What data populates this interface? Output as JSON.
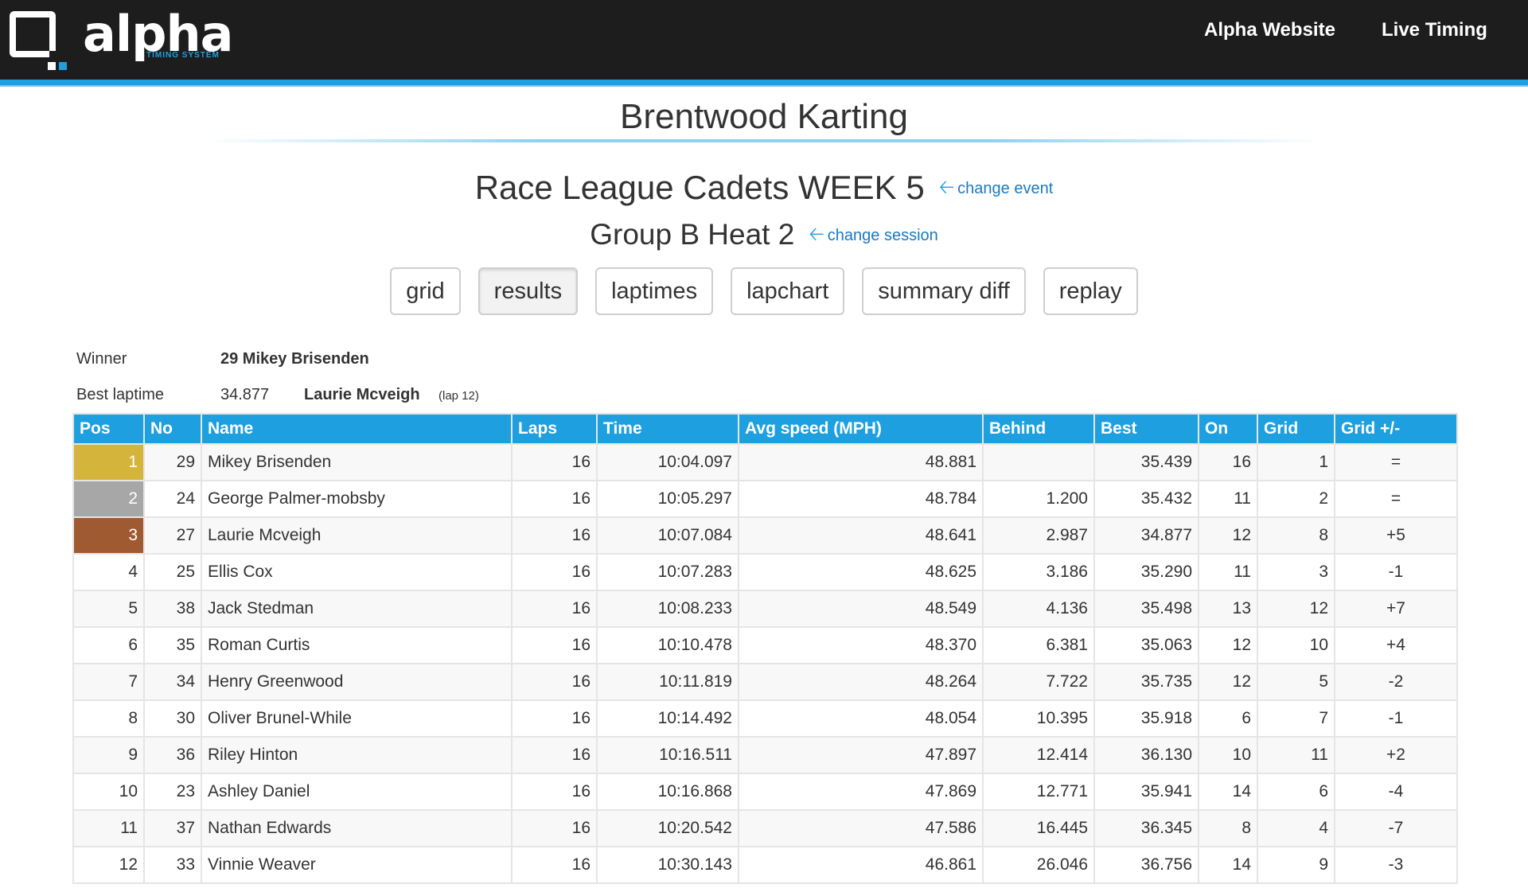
{
  "header": {
    "logo_text": "alpha",
    "logo_sub": "TIMING SYSTEM",
    "nav": [
      "Alpha Website",
      "Live Timing"
    ]
  },
  "venue": "Brentwood Karting",
  "event": {
    "title": "Race League Cadets WEEK 5",
    "change_label": "change event"
  },
  "session": {
    "title": "Group B Heat 2",
    "change_label": "change session"
  },
  "tabs": [
    "grid",
    "results",
    "laptimes",
    "lapchart",
    "summary diff",
    "replay"
  ],
  "active_tab": "results",
  "summary": {
    "winner_label": "Winner",
    "winner_value": "29 Mikey Brisenden",
    "best_label": "Best laptime",
    "best_time": "34.877",
    "best_driver": "Laurie Mcveigh",
    "best_lap": "(lap 12)"
  },
  "table": {
    "columns": [
      "Pos",
      "No",
      "Name",
      "Laps",
      "Time",
      "Avg speed (MPH)",
      "Behind",
      "Best",
      "On",
      "Grid",
      "Grid +/-"
    ],
    "rows": [
      [
        "1",
        "29",
        "Mikey Brisenden",
        "16",
        "10:04.097",
        "48.881",
        "",
        "35.439",
        "16",
        "1",
        "="
      ],
      [
        "2",
        "24",
        "George Palmer-mobsby",
        "16",
        "10:05.297",
        "48.784",
        "1.200",
        "35.432",
        "11",
        "2",
        "="
      ],
      [
        "3",
        "27",
        "Laurie Mcveigh",
        "16",
        "10:07.084",
        "48.641",
        "2.987",
        "34.877",
        "12",
        "8",
        "+5"
      ],
      [
        "4",
        "25",
        "Ellis Cox",
        "16",
        "10:07.283",
        "48.625",
        "3.186",
        "35.290",
        "11",
        "3",
        "-1"
      ],
      [
        "5",
        "38",
        "Jack Stedman",
        "16",
        "10:08.233",
        "48.549",
        "4.136",
        "35.498",
        "13",
        "12",
        "+7"
      ],
      [
        "6",
        "35",
        "Roman Curtis",
        "16",
        "10:10.478",
        "48.370",
        "6.381",
        "35.063",
        "12",
        "10",
        "+4"
      ],
      [
        "7",
        "34",
        "Henry Greenwood",
        "16",
        "10:11.819",
        "48.264",
        "7.722",
        "35.735",
        "12",
        "5",
        "-2"
      ],
      [
        "8",
        "30",
        "Oliver Brunel-While",
        "16",
        "10:14.492",
        "48.054",
        "10.395",
        "35.918",
        "6",
        "7",
        "-1"
      ],
      [
        "9",
        "36",
        "Riley Hinton",
        "16",
        "10:16.511",
        "47.897",
        "12.414",
        "36.130",
        "10",
        "11",
        "+2"
      ],
      [
        "10",
        "23",
        "Ashley Daniel",
        "16",
        "10:16.868",
        "47.869",
        "12.771",
        "35.941",
        "14",
        "6",
        "-4"
      ],
      [
        "11",
        "37",
        "Nathan Edwards",
        "16",
        "10:20.542",
        "47.586",
        "16.445",
        "36.345",
        "8",
        "4",
        "-7"
      ],
      [
        "12",
        "33",
        "Vinnie Weaver",
        "16",
        "10:30.143",
        "46.861",
        "26.046",
        "36.756",
        "14",
        "9",
        "-3"
      ]
    ]
  },
  "colors": {
    "accent": "#1ea0e0",
    "gold": "#d5b43c",
    "silver": "#a7a7a7",
    "bronze": "#a05a32",
    "best_overall": "#e020c0",
    "positive": "#2ca02c",
    "negative": "#f0a020"
  }
}
